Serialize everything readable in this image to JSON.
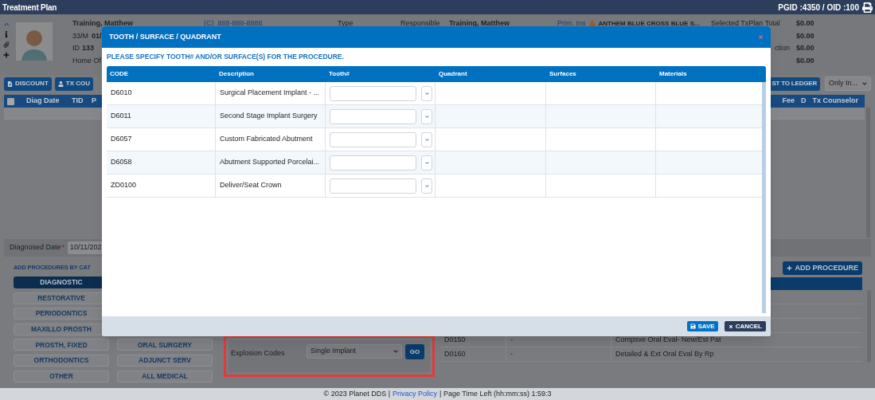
{
  "window": {
    "title": "Treatment Plan",
    "ids": "PGID :4350  /  OID :100"
  },
  "patient": {
    "name": "Training, Matthew",
    "age_sex": "33/M",
    "dob": "01/",
    "id_label": "ID",
    "id": "133",
    "office": "Home Of",
    "phone": "(C)  888-888-8888",
    "type_label": "Type",
    "responsible_label": "Responsible",
    "responsible": "Training, Matthew",
    "prim_ins_label": "Prim. Ins",
    "prim_ins": "ANTHEM BLUE CROSS BLUE S...",
    "totals": [
      {
        "label": "Selected TxPlan Total",
        "value": "$0.00"
      },
      {
        "value": "$0.00"
      },
      {
        "label": "ction",
        "value": "$0.00"
      },
      {
        "value": "$0.00"
      }
    ]
  },
  "toolbar": {
    "buttons": [
      "DISCOUNT",
      "TX COU"
    ],
    "ledger_button": "ST TO LEDGER",
    "filter": "Only In..."
  },
  "plan_table": {
    "select_all": false,
    "columns_left": [
      "Diag Date",
      "TID",
      "P"
    ],
    "columns_right": [
      "Fee",
      "D",
      "Tx Counselor"
    ]
  },
  "diagnosed_date": {
    "label": "Diagnosed Date",
    "required_mark": "*",
    "value": "10/11/202"
  },
  "categories": {
    "title": "ADD PROCEDURES BY CAT",
    "rows": [
      {
        "items": [
          {
            "label": "DIAGNOSTIC",
            "selected": true
          }
        ]
      },
      {
        "items": [
          {
            "label": "RESTORATIVE",
            "selected": false
          }
        ]
      },
      {
        "items": [
          {
            "label": "PERIODONTICS",
            "selected": false
          }
        ]
      },
      {
        "items": [
          {
            "label": "MAXILLO PROSTH",
            "selected": false
          }
        ]
      },
      {
        "items": [
          {
            "label": "PROSTH, FIXED",
            "selected": false
          },
          {
            "label": "ORAL SURGERY",
            "selected": false
          }
        ]
      },
      {
        "items": [
          {
            "label": "ORTHODONTICS",
            "selected": false
          },
          {
            "label": "ADJUNCT SERV",
            "selected": false
          }
        ]
      },
      {
        "items": [
          {
            "label": "OTHER",
            "selected": false
          },
          {
            "label": "ALL MEDICAL",
            "selected": false
          }
        ]
      }
    ]
  },
  "explosion": {
    "label": "Explosion Codes",
    "value": "Single Implant",
    "go": "GO"
  },
  "add_procedure": "ADD PROCEDURE",
  "procedures": [
    {
      "code": "D0150",
      "column_2": "-",
      "description": "Compsve Oral Eval- New/Est Pat"
    },
    {
      "code": "D0160",
      "column_2": "-",
      "description": "Detailed & Ext Oral Eval By Rp"
    }
  ],
  "modal": {
    "title": "TOOTH / SURFACE / QUADRANT",
    "instruction": "PLEASE SPECIFY TOOTH# AND/OR SURFACE(S) FOR THE PROCEDURE.",
    "columns": [
      "CODE",
      "Description",
      "Tooth#",
      "Quadrant",
      "Surfaces",
      "Materials"
    ],
    "rows": [
      {
        "code": "D6010",
        "description": "Surgical Placement Implant - ..."
      },
      {
        "code": "D6011",
        "description": "Second Stage Implant Surgery"
      },
      {
        "code": "D6057",
        "description": "Custom Fabricated Abutment"
      },
      {
        "code": "D6058",
        "description": "Abutment Supported Porcelai..."
      },
      {
        "code": "ZD0100",
        "description": "Deliver/Seat Crown"
      }
    ],
    "save": "SAVE",
    "cancel": "CANCEL"
  },
  "footer": {
    "copyright": "© 2023 Planet DDS |",
    "link": "Privacy Policy",
    "timer": "| Page Time Left (hh:mm:ss) 1:59:3"
  }
}
